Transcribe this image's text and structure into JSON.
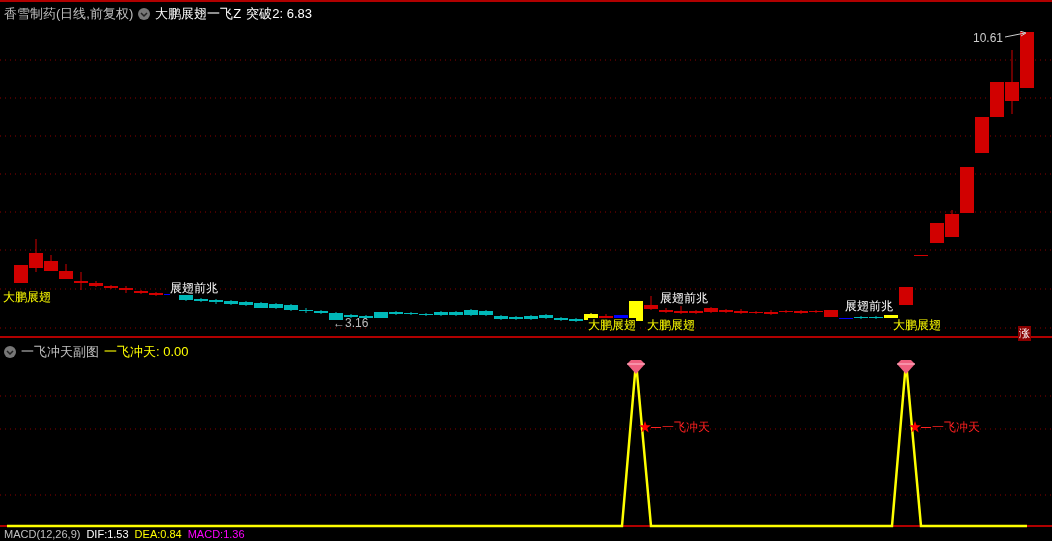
{
  "main_panel": {
    "title": "香雪制药(日线,前复权)",
    "indicator": "大鹏展翅一飞Z",
    "readout": "突破2: 6.83",
    "high_label": "10.61",
    "low_label": "←3.16",
    "signals": [
      {
        "kind": "fly",
        "text": "大鹏展翅"
      },
      {
        "kind": "pre",
        "text": "展翅前兆"
      },
      {
        "kind": "fly",
        "text": "大鹏展翅"
      },
      {
        "kind": "pre",
        "text": "展翅前兆"
      },
      {
        "kind": "fly",
        "text": "大鹏展翅"
      },
      {
        "kind": "pre",
        "text": "展翅前兆"
      },
      {
        "kind": "fly",
        "text": "大鹏展翅"
      }
    ],
    "badge": "涨"
  },
  "sub_panel": {
    "title": "一飞冲天副图",
    "readout": "一飞冲天: 0.00",
    "markers": [
      {
        "text": "一飞冲天"
      },
      {
        "text": "一飞冲天"
      }
    ]
  },
  "macd_panel": {
    "title": "MACD(12,26,9)",
    "dif": "DIF:1.53",
    "dea": "DEA:0.84",
    "macd": "MACD:1.36"
  }
}
